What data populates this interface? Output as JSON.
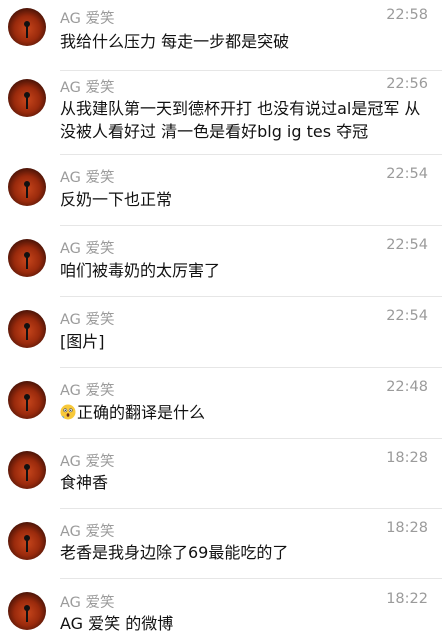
{
  "conversations": [
    {
      "sender": "AG 爱笑",
      "time": "22:58",
      "text": "我给什么压力 每走一步都是突破"
    },
    {
      "sender": "AG 爱笑",
      "time": "22:56",
      "text": "从我建队第一天到德杯开打 也没有说过al是冠军 从没被人看好过 清一色是看好blg ig tes 夺冠"
    },
    {
      "sender": "AG 爱笑",
      "time": "22:54",
      "text": "反奶一下也正常"
    },
    {
      "sender": "AG 爱笑",
      "time": "22:54",
      "text": "咱们被毒奶的太厉害了"
    },
    {
      "sender": "AG 爱笑",
      "time": "22:54",
      "text": "[图片]"
    },
    {
      "sender": "AG 爱笑",
      "time": "22:48",
      "text": "正确的翻译是什么",
      "emoji": "astonished-face-emoji"
    },
    {
      "sender": "AG 爱笑",
      "time": "18:28",
      "text": "食神香"
    },
    {
      "sender": "AG 爱笑",
      "time": "18:28",
      "text": "老香是我身边除了69最能吃的了"
    },
    {
      "sender": "AG 爱笑",
      "time": "18:22",
      "text": "AG 爱笑 的微博"
    }
  ],
  "colors": {
    "meta_text": "#9b9b9b",
    "body_text": "#111111",
    "divider": "#e6e6e6",
    "avatar_red": "#c8461c"
  }
}
